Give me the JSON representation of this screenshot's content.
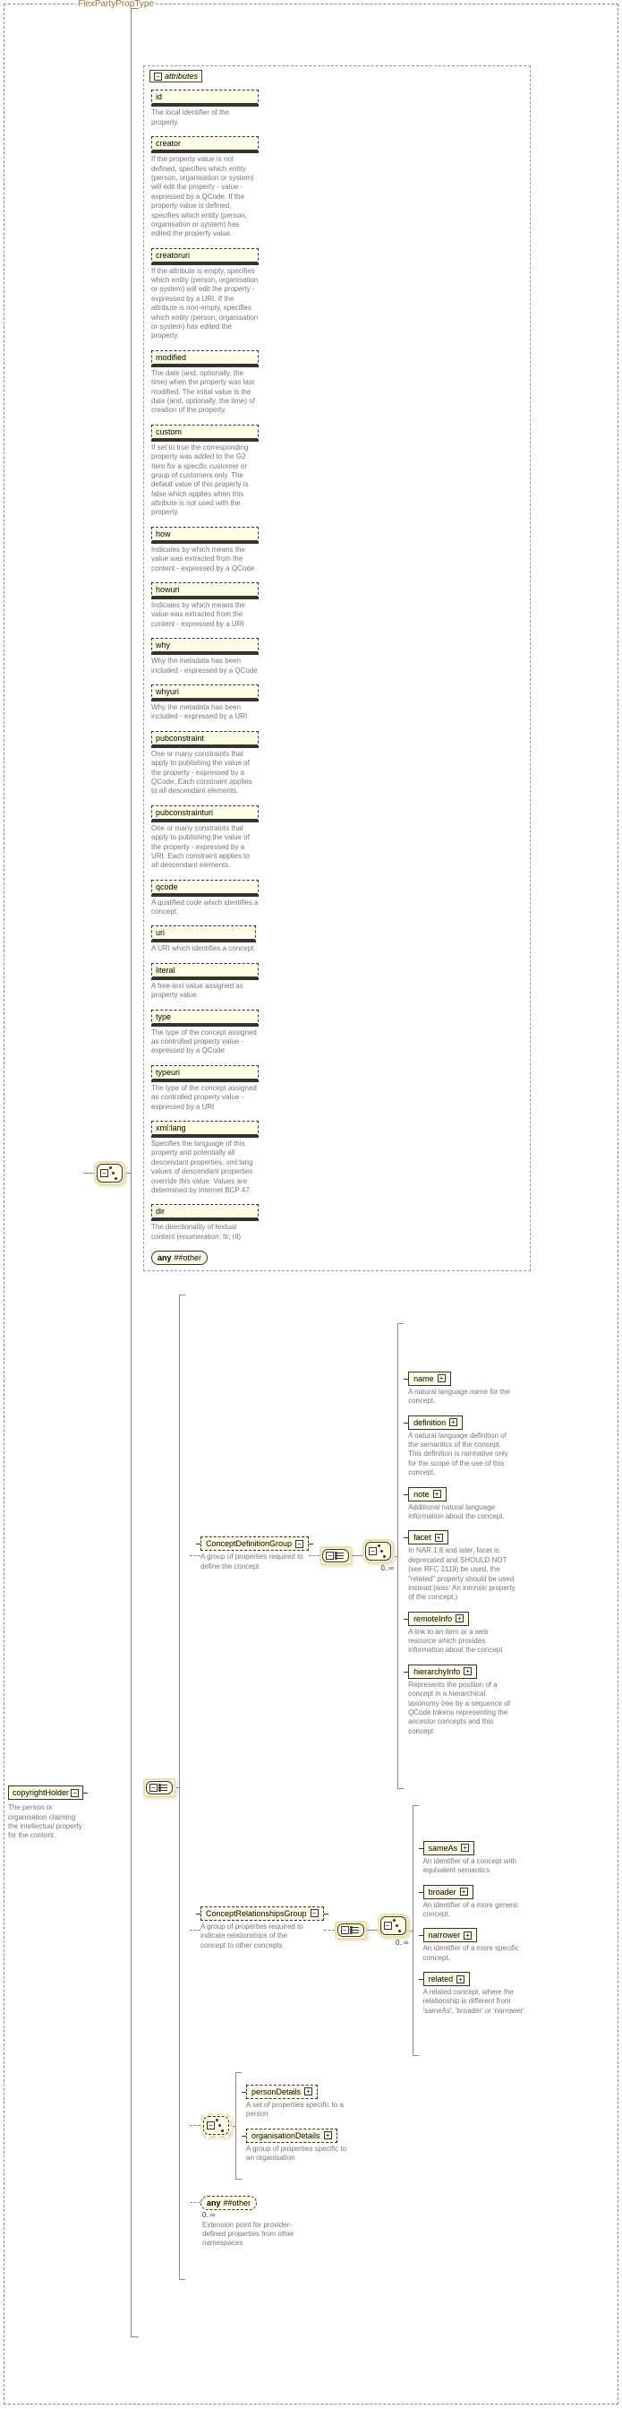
{
  "type_header": "FlexPartyPropType",
  "root": {
    "label": "copyrightHolder",
    "desc": "The person or organisation claiming the intellectual property for the content."
  },
  "attributes_header": "attributes",
  "attrs": {
    "id": {
      "label": "id",
      "desc": "The local identifier of the property."
    },
    "creator": {
      "label": "creator",
      "desc": "If the property value is not defined, specifies which entity (person, organisation or system) will edit the property - value - expressed by a QCode. If the property value is defined, specifies which entity (person, organisation or system) has edited the property value."
    },
    "creatoruri": {
      "label": "creatoruri",
      "desc": "If the attribute is empty, specifies which entity (person, organisation or system) will edit the property - expressed by a URI. If the attribute is non-empty, specifies which entity (person, organisation or system) has edited the property."
    },
    "modified": {
      "label": "modified",
      "desc": "The date (and, optionally, the time) when the property was last modified. The initial value is the date (and, optionally, the time) of creation of the property."
    },
    "custom": {
      "label": "custom",
      "desc": "If set to true the corresponding property was added to the G2 Item for a specific customer or group of customers only. The default value of this property is false which applies when this attribute is not used with the property."
    },
    "how": {
      "label": "how",
      "desc": "Indicates by which means the value was extracted from the content - expressed by a QCode"
    },
    "howuri": {
      "label": "howuri",
      "desc": "Indicates by which means the value was extracted from the content - expressed by a URI"
    },
    "why": {
      "label": "why",
      "desc": "Why the metadata has been included - expressed by a QCode"
    },
    "whyuri": {
      "label": "whyuri",
      "desc": "Why the metadata has been included - expressed by a URI"
    },
    "pubconstraint": {
      "label": "pubconstraint",
      "desc": "One or many constraints that apply to publishing the value of the property - expressed by a QCode. Each constraint applies to all descendant elements."
    },
    "pubconstrainturi": {
      "label": "pubconstrainturi",
      "desc": "One or many constraints that apply to publishing the value of the property - expressed by a URI. Each constraint applies to all descendant elements."
    },
    "qcode": {
      "label": "qcode",
      "desc": "A qualified code which identifies a concept."
    },
    "uri": {
      "label": "uri",
      "desc": "A URI which identifies a concept."
    },
    "literal": {
      "label": "literal",
      "desc": "A free-text value assigned as property value."
    },
    "type": {
      "label": "type",
      "desc": "The type of the concept assigned as controlled property value - expressed by a QCode"
    },
    "typeuri": {
      "label": "typeuri",
      "desc": "The type of the concept assigned as controlled property value - expressed by a URI"
    },
    "xmllang": {
      "label": "xml:lang",
      "desc": "Specifies the language of this property and potentially all descendant properties. xml:lang values of descendant properties override this value. Values are determined by Internet BCP 47."
    },
    "dir": {
      "label": "dir",
      "desc": "The directionality of textual content (enumeration: ltr, rtl)"
    }
  },
  "any_other": {
    "prefix": "any",
    "suffix": "##other"
  },
  "groups": {
    "cdg": {
      "label": "ConceptDefinitionGroup",
      "desc": "A group of properties required to define the concept"
    },
    "crg": {
      "label": "ConceptRelationshipsGroup",
      "desc": "A group of properties required to indicate relationships of the concept to other concepts"
    }
  },
  "cdg_children": {
    "name": {
      "label": "name",
      "desc": "A natural language name for the concept."
    },
    "definition": {
      "label": "definition",
      "desc": "A natural language definition of the semantics of the concept. This definition is normative only for the scope of the use of this concept."
    },
    "note": {
      "label": "note",
      "desc": "Additional natural language information about the concept."
    },
    "facet": {
      "label": "facet",
      "desc": "In NAR 1.8 and later, facet is deprecated and SHOULD NOT (see RFC 2119) be used, the \"related\" property should be used instead.(was: An intrinsic property of the concept.)"
    },
    "remoteInfo": {
      "label": "remoteInfo",
      "desc": "A link to an item or a web resource which provides information about the concept"
    },
    "hierarchyInfo": {
      "label": "hierarchyInfo",
      "desc": "Represents the position of a concept in a hierarchical taxonomy tree by a sequence of QCode tokens representing the ancestor concepts and this concept"
    }
  },
  "crg_children": {
    "sameAs": {
      "label": "sameAs",
      "desc": "An identifier of a concept with equivalent semantics"
    },
    "broader": {
      "label": "broader",
      "desc": "An identifier of a more generic concept."
    },
    "narrower": {
      "label": "narrower",
      "desc": "An identifier of a more specific concept."
    },
    "related": {
      "label": "related",
      "desc": "A related concept, where the relationship is different from 'sameAs', 'broader' or 'narrower'."
    }
  },
  "lower_choice": {
    "personDetails": {
      "label": "personDetails",
      "desc": "A set of properties specific to a person"
    },
    "organisationDetails": {
      "label": "organisationDetails",
      "desc": "A group of properties specific to an organisation"
    }
  },
  "bottom_any": {
    "prefix": "any",
    "suffix": "##other",
    "occurs": "0..∞",
    "desc": "Extension point for provider-defined properties from other namespaces"
  },
  "occ": {
    "zi": "0..∞"
  }
}
